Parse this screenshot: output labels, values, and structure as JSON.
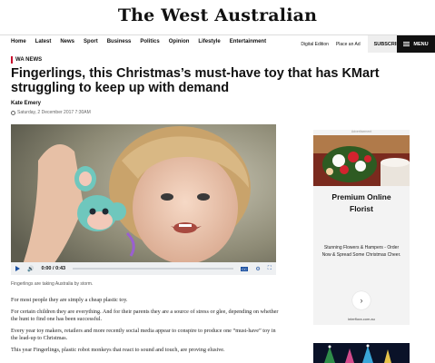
{
  "masthead": {
    "title": "The West Australian"
  },
  "nav": {
    "items": [
      "Home",
      "Latest",
      "News",
      "Sport",
      "Business",
      "Politics",
      "Opinion",
      "Lifestyle",
      "Entertainment"
    ],
    "digital_edition": "Digital Edition",
    "place_ad": "Place an Ad",
    "subscribe": "SUBSCRIBE",
    "menu": "MENU"
  },
  "article": {
    "section": "WA NEWS",
    "headline": "Fingerlings, this Christmas’s must-have toy that has KMart struggling to keep up with demand",
    "author": "Kate Emery",
    "date": "Saturday, 2 December 2017 7:30AM",
    "caption": "Fingerlings are taking Australia by storm.",
    "paragraphs": [
      "For most people they are simply a cheap plastic toy.",
      "For certain children they are everything. And for their parents they are a source of stress or glee, depending on whether the hunt to find one has been successful.",
      "Every year toy makers, retailers and more recently social media appear to conspire to produce one “must-have” toy in the lead-up to Christmas.",
      "This year Fingerlings, plastic robot monkeys that react to sound and touch, are proving elusive."
    ]
  },
  "video": {
    "time": "0:00 / 0:43",
    "cc": "CC"
  },
  "ad": {
    "label": "Advertisement",
    "title_line1": "Premium Online",
    "title_line2": "Florist",
    "text": "Stunning Flowers & Hampers - Order Now & Spread Some Christmas Cheer.",
    "domain": "interflora.com.au"
  },
  "colors": {
    "accent": "#c8102e",
    "video_controls": "#1a4fa0",
    "menu_bg": "#111111"
  },
  "icons": [
    "play-icon",
    "volume-icon",
    "cc-icon",
    "settings-icon",
    "fullscreen-icon",
    "clock-icon",
    "menu-icon",
    "chevron-right-icon"
  ]
}
